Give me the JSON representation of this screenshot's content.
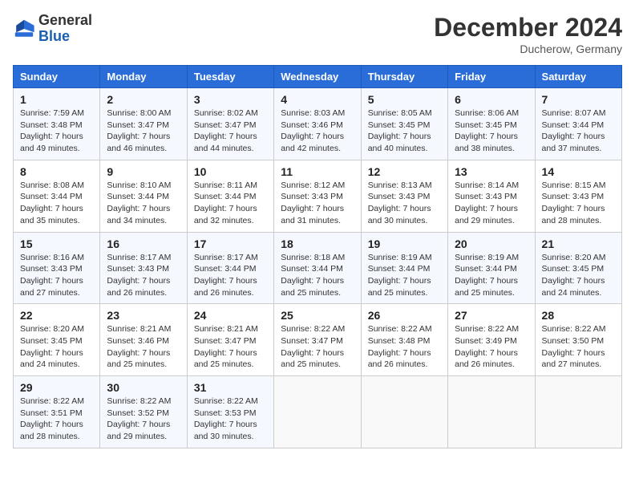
{
  "logo": {
    "general": "General",
    "blue": "Blue"
  },
  "header": {
    "month": "December 2024",
    "location": "Ducherow, Germany"
  },
  "days_of_week": [
    "Sunday",
    "Monday",
    "Tuesday",
    "Wednesday",
    "Thursday",
    "Friday",
    "Saturday"
  ],
  "weeks": [
    [
      {
        "day": "1",
        "sunrise": "7:59 AM",
        "sunset": "3:48 PM",
        "daylight": "7 hours and 49 minutes."
      },
      {
        "day": "2",
        "sunrise": "8:00 AM",
        "sunset": "3:47 PM",
        "daylight": "7 hours and 46 minutes."
      },
      {
        "day": "3",
        "sunrise": "8:02 AM",
        "sunset": "3:47 PM",
        "daylight": "7 hours and 44 minutes."
      },
      {
        "day": "4",
        "sunrise": "8:03 AM",
        "sunset": "3:46 PM",
        "daylight": "7 hours and 42 minutes."
      },
      {
        "day": "5",
        "sunrise": "8:05 AM",
        "sunset": "3:45 PM",
        "daylight": "7 hours and 40 minutes."
      },
      {
        "day": "6",
        "sunrise": "8:06 AM",
        "sunset": "3:45 PM",
        "daylight": "7 hours and 38 minutes."
      },
      {
        "day": "7",
        "sunrise": "8:07 AM",
        "sunset": "3:44 PM",
        "daylight": "7 hours and 37 minutes."
      }
    ],
    [
      {
        "day": "8",
        "sunrise": "8:08 AM",
        "sunset": "3:44 PM",
        "daylight": "7 hours and 35 minutes."
      },
      {
        "day": "9",
        "sunrise": "8:10 AM",
        "sunset": "3:44 PM",
        "daylight": "7 hours and 34 minutes."
      },
      {
        "day": "10",
        "sunrise": "8:11 AM",
        "sunset": "3:44 PM",
        "daylight": "7 hours and 32 minutes."
      },
      {
        "day": "11",
        "sunrise": "8:12 AM",
        "sunset": "3:43 PM",
        "daylight": "7 hours and 31 minutes."
      },
      {
        "day": "12",
        "sunrise": "8:13 AM",
        "sunset": "3:43 PM",
        "daylight": "7 hours and 30 minutes."
      },
      {
        "day": "13",
        "sunrise": "8:14 AM",
        "sunset": "3:43 PM",
        "daylight": "7 hours and 29 minutes."
      },
      {
        "day": "14",
        "sunrise": "8:15 AM",
        "sunset": "3:43 PM",
        "daylight": "7 hours and 28 minutes."
      }
    ],
    [
      {
        "day": "15",
        "sunrise": "8:16 AM",
        "sunset": "3:43 PM",
        "daylight": "7 hours and 27 minutes."
      },
      {
        "day": "16",
        "sunrise": "8:17 AM",
        "sunset": "3:43 PM",
        "daylight": "7 hours and 26 minutes."
      },
      {
        "day": "17",
        "sunrise": "8:17 AM",
        "sunset": "3:44 PM",
        "daylight": "7 hours and 26 minutes."
      },
      {
        "day": "18",
        "sunrise": "8:18 AM",
        "sunset": "3:44 PM",
        "daylight": "7 hours and 25 minutes."
      },
      {
        "day": "19",
        "sunrise": "8:19 AM",
        "sunset": "3:44 PM",
        "daylight": "7 hours and 25 minutes."
      },
      {
        "day": "20",
        "sunrise": "8:19 AM",
        "sunset": "3:44 PM",
        "daylight": "7 hours and 25 minutes."
      },
      {
        "day": "21",
        "sunrise": "8:20 AM",
        "sunset": "3:45 PM",
        "daylight": "7 hours and 24 minutes."
      }
    ],
    [
      {
        "day": "22",
        "sunrise": "8:20 AM",
        "sunset": "3:45 PM",
        "daylight": "7 hours and 24 minutes."
      },
      {
        "day": "23",
        "sunrise": "8:21 AM",
        "sunset": "3:46 PM",
        "daylight": "7 hours and 25 minutes."
      },
      {
        "day": "24",
        "sunrise": "8:21 AM",
        "sunset": "3:47 PM",
        "daylight": "7 hours and 25 minutes."
      },
      {
        "day": "25",
        "sunrise": "8:22 AM",
        "sunset": "3:47 PM",
        "daylight": "7 hours and 25 minutes."
      },
      {
        "day": "26",
        "sunrise": "8:22 AM",
        "sunset": "3:48 PM",
        "daylight": "7 hours and 26 minutes."
      },
      {
        "day": "27",
        "sunrise": "8:22 AM",
        "sunset": "3:49 PM",
        "daylight": "7 hours and 26 minutes."
      },
      {
        "day": "28",
        "sunrise": "8:22 AM",
        "sunset": "3:50 PM",
        "daylight": "7 hours and 27 minutes."
      }
    ],
    [
      {
        "day": "29",
        "sunrise": "8:22 AM",
        "sunset": "3:51 PM",
        "daylight": "7 hours and 28 minutes."
      },
      {
        "day": "30",
        "sunrise": "8:22 AM",
        "sunset": "3:52 PM",
        "daylight": "7 hours and 29 minutes."
      },
      {
        "day": "31",
        "sunrise": "8:22 AM",
        "sunset": "3:53 PM",
        "daylight": "7 hours and 30 minutes."
      },
      null,
      null,
      null,
      null
    ]
  ],
  "labels": {
    "sunrise": "Sunrise:",
    "sunset": "Sunset:",
    "daylight": "Daylight:"
  }
}
